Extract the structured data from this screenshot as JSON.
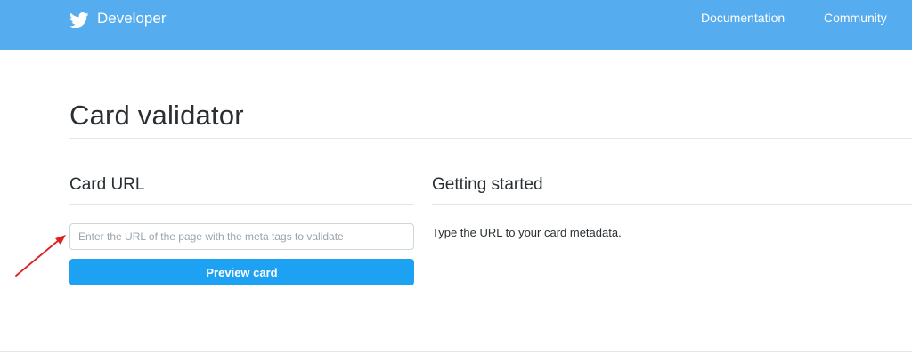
{
  "header": {
    "brand_label": "Developer",
    "brand_icon": "twitter-bird-icon",
    "nav": [
      {
        "label": "Documentation"
      },
      {
        "label": "Community"
      }
    ],
    "background_color": "#55acee"
  },
  "page": {
    "title": "Card validator"
  },
  "card_url": {
    "heading": "Card URL",
    "input_value": "",
    "input_placeholder": "Enter the URL of the page with the meta tags to validate",
    "button_label": "Preview card",
    "button_color": "#1da1f2"
  },
  "getting_started": {
    "heading": "Getting started",
    "text": "Type the URL to your card metadata."
  },
  "annotation": {
    "arrow_icon": "red-arrow-icon",
    "arrow_color": "#e02020"
  }
}
